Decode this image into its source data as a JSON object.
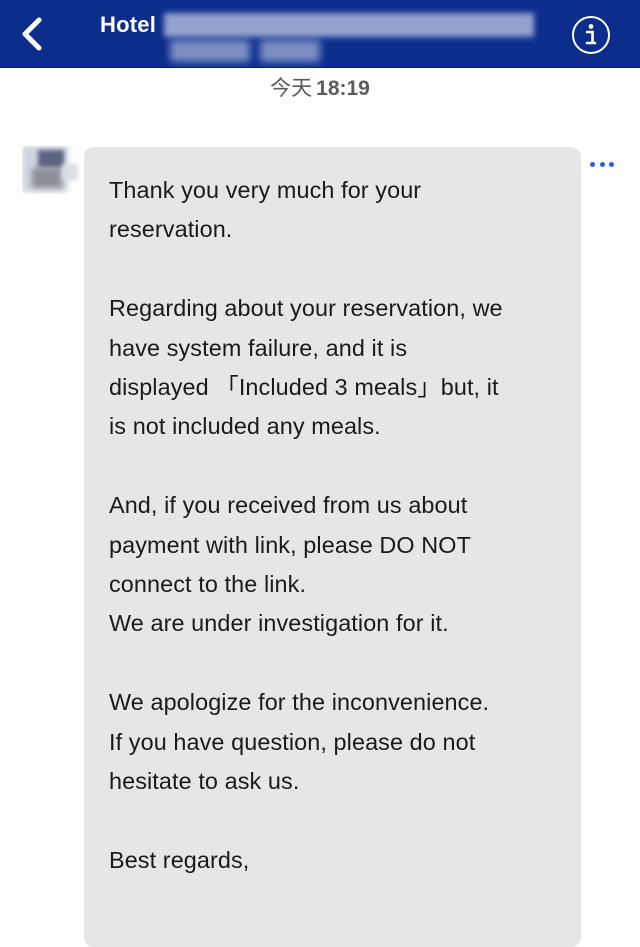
{
  "header": {
    "title": "Hotel",
    "back_icon": "chevron-left-icon",
    "info_icon": "info-icon",
    "background_color": "#0c2d8c"
  },
  "timestamp": {
    "day": "今天",
    "time": "18:19"
  },
  "message": {
    "avatar_icon": "avatar",
    "bubble_color": "#e6e6e6",
    "paragraphs": [
      "Thank you very much for your\nreservation.",
      "Regarding about your reservation, we\nhave system failure, and it is\ndisplayed 「Included 3 meals」but, it\nis not included any meals.",
      "And, if you received from us about\npayment with link, please DO NOT\nconnect to the link.\nWe are under investigation for it.",
      "We apologize for the inconvenience.\nIf you have question, please do not\nhesitate to ask us.",
      "Best regards,"
    ],
    "more_icon": "more-horizontal-icon"
  }
}
